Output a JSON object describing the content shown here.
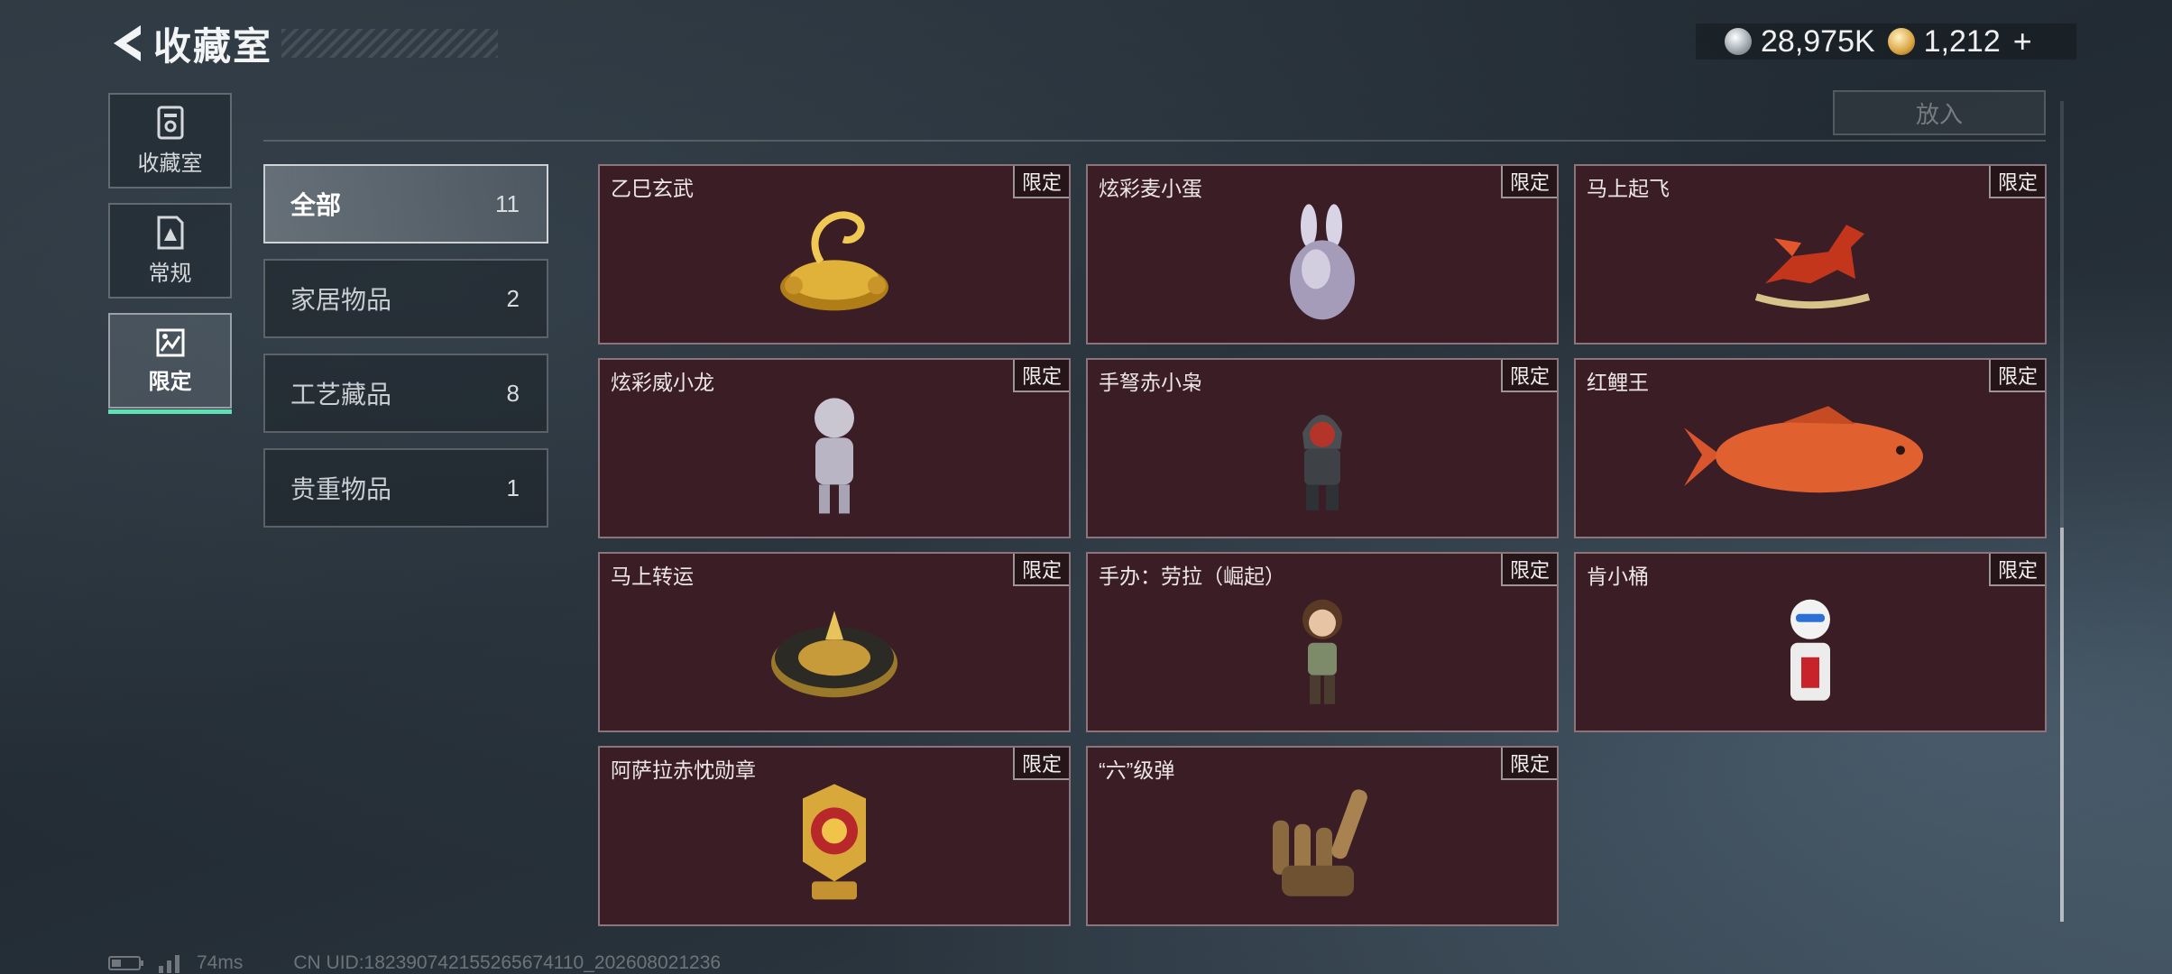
{
  "header": {
    "title": "收藏室",
    "currencies": [
      {
        "icon": "silver-coin-icon",
        "value": "28,975K"
      },
      {
        "icon": "gold-coin-icon",
        "value": "1,212"
      }
    ],
    "plus_label": "+"
  },
  "rail": [
    {
      "label": "收藏室",
      "icon": "storage-icon",
      "active": false
    },
    {
      "label": "常规",
      "icon": "document-icon",
      "active": false
    },
    {
      "label": "限定",
      "icon": "limited-image-icon",
      "active": true
    }
  ],
  "toolbar": {
    "place_label": "放入"
  },
  "categories": [
    {
      "name": "全部",
      "count": "11",
      "active": true
    },
    {
      "name": "家居物品",
      "count": "2",
      "active": false
    },
    {
      "name": "工艺藏品",
      "count": "8",
      "active": false
    },
    {
      "name": "贵重物品",
      "count": "1",
      "active": false
    }
  ],
  "items": [
    {
      "name": "乙巳玄武",
      "tag": "限定",
      "art": "golden-tortoise-snake-icon"
    },
    {
      "name": "炫彩麦小蛋",
      "tag": "限定",
      "art": "rabbit-egg-icon"
    },
    {
      "name": "马上起飞",
      "tag": "限定",
      "art": "red-horse-icon"
    },
    {
      "name": "炫彩威小龙",
      "tag": "限定",
      "art": "silver-figure-icon"
    },
    {
      "name": "手弩赤小枭",
      "tag": "限定",
      "art": "hooded-figure-icon"
    },
    {
      "name": "红鲤王",
      "tag": "限定",
      "art": "red-carp-icon"
    },
    {
      "name": "马上转运",
      "tag": "限定",
      "art": "golden-compass-icon"
    },
    {
      "name": "手办：劳拉（崛起）",
      "tag": "限定",
      "art": "lara-figure-icon"
    },
    {
      "name": "肯小桶",
      "tag": "限定",
      "art": "colonel-figure-icon"
    },
    {
      "name": "阿萨拉赤忱勋章",
      "tag": "限定",
      "art": "gold-medal-icon"
    },
    {
      "name": "“六”级弹",
      "tag": "限定",
      "art": "bullet-hand-icon"
    }
  ],
  "footer": {
    "ping": "74ms",
    "uid": "CN UID:1823907421552656741​10_202608021236"
  }
}
